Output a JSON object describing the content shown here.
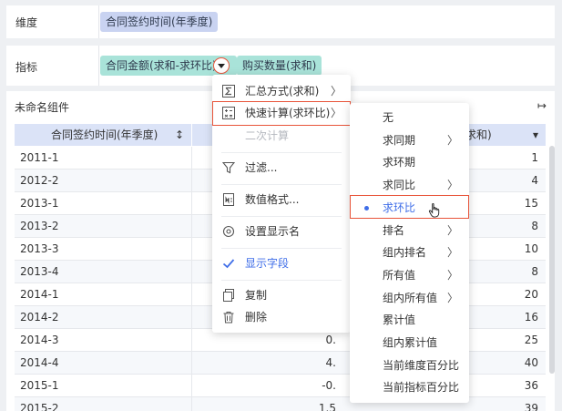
{
  "dimension_row": {
    "label": "维度",
    "chip": "合同签约时间(年季度)"
  },
  "measure_row": {
    "label": "指标",
    "chip1": "合同金额(求和-求环比)",
    "chip2": "购买数量(求和)"
  },
  "widget": {
    "title": "未命名组件",
    "expand_icon": "↦",
    "columns": {
      "date": "合同签约时间(年季度)",
      "sort_icon": "↕",
      "v2": "求和)",
      "v2_dropdown": "▾"
    },
    "rows": [
      {
        "date": "2011-1",
        "v1": "",
        "v2": "1"
      },
      {
        "date": "2012-2",
        "v1": "",
        "v2": "4"
      },
      {
        "date": "2013-1",
        "v1": "",
        "v2": "15"
      },
      {
        "date": "2013-2",
        "v1": "",
        "v2": "8"
      },
      {
        "date": "2013-3",
        "v1": "",
        "v2": "10"
      },
      {
        "date": "2013-4",
        "v1": "",
        "v2": "8"
      },
      {
        "date": "2014-1",
        "v1": "",
        "v2": "20"
      },
      {
        "date": "2014-2",
        "v1": "",
        "v2": "16"
      },
      {
        "date": "2014-3",
        "v1": "0.",
        "v2": "25"
      },
      {
        "date": "2014-4",
        "v1": "4.",
        "v2": "40"
      },
      {
        "date": "2015-1",
        "v1": "-0.",
        "v2": "36"
      },
      {
        "date": "2015-2",
        "v1": "1.5",
        "v2": "39"
      }
    ]
  },
  "context_menu": {
    "items": [
      {
        "label": "汇总方式(求和)",
        "icon": "sigma-icon"
      },
      {
        "label": "快速计算(求环比)",
        "icon": "calc-icon"
      },
      {
        "label": "二次计算"
      },
      {
        "label": "过滤...",
        "icon": "filter-icon"
      },
      {
        "label": "数值格式...",
        "icon": "format-icon"
      },
      {
        "label": "设置显示名",
        "icon": "gear-icon"
      },
      {
        "label": "显示字段",
        "icon": "check-icon"
      },
      {
        "label": "复制",
        "icon": "copy-icon"
      },
      {
        "label": "删除",
        "icon": "trash-icon"
      }
    ]
  },
  "submenu": {
    "items": [
      {
        "label": "无"
      },
      {
        "label": "求同期"
      },
      {
        "label": "求环期"
      },
      {
        "label": "求同比"
      },
      {
        "label": "求环比"
      },
      {
        "label": "排名"
      },
      {
        "label": "组内排名"
      },
      {
        "label": "所有值"
      },
      {
        "label": "组内所有值"
      },
      {
        "label": "累计值"
      },
      {
        "label": "组内累计值"
      },
      {
        "label": "当前维度百分比"
      },
      {
        "label": "当前指标百分比"
      }
    ]
  },
  "colors": {
    "accent": "#3f6ee8",
    "highlight_border": "#e8543a",
    "dimension_chip": "#c9d3f1",
    "measure_chip": "#a9e3d9"
  }
}
